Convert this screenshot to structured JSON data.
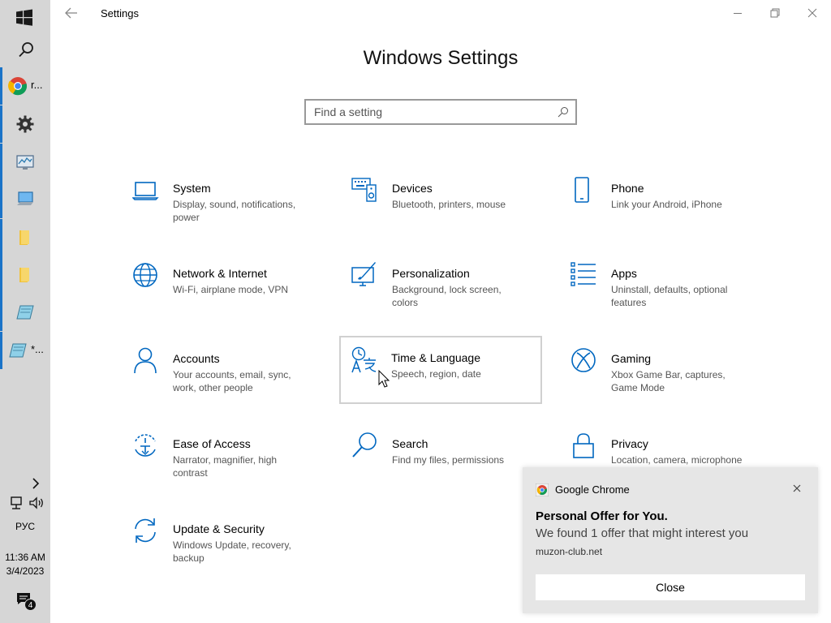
{
  "window": {
    "title": "Settings",
    "back_icon": "back-arrow-icon",
    "controls": [
      "minimize-icon",
      "restore-icon",
      "close-icon"
    ]
  },
  "page": {
    "title": "Windows Settings",
    "search_placeholder": "Find a setting",
    "search_value": ""
  },
  "accent": "#0067c0",
  "categories": [
    {
      "name": "System",
      "desc": "Display, sound, notifications, power",
      "icon": "laptop-icon"
    },
    {
      "name": "Devices",
      "desc": "Bluetooth, printers, mouse",
      "icon": "devices-icon"
    },
    {
      "name": "Phone",
      "desc": "Link your Android, iPhone",
      "icon": "phone-icon"
    },
    {
      "name": "Network & Internet",
      "desc": "Wi-Fi, airplane mode, VPN",
      "icon": "globe-icon"
    },
    {
      "name": "Personalization",
      "desc": "Background, lock screen, colors",
      "icon": "personalization-icon"
    },
    {
      "name": "Apps",
      "desc": "Uninstall, defaults, optional features",
      "icon": "apps-list-icon"
    },
    {
      "name": "Accounts",
      "desc": "Your accounts, email, sync, work, other people",
      "icon": "person-icon"
    },
    {
      "name": "Time & Language",
      "desc": "Speech, region, date",
      "icon": "time-language-icon"
    },
    {
      "name": "Gaming",
      "desc": "Xbox Game Bar, captures, Game Mode",
      "icon": "xbox-icon"
    },
    {
      "name": "Ease of Access",
      "desc": "Narrator, magnifier, high contrast",
      "icon": "ease-of-access-icon"
    },
    {
      "name": "Search",
      "desc": "Find my files, permissions",
      "icon": "search-icon"
    },
    {
      "name": "Privacy",
      "desc": "Location, camera, microphone",
      "icon": "lock-icon"
    },
    {
      "name": "Update & Security",
      "desc": "Windows Update, recovery, backup",
      "icon": "refresh-icon"
    }
  ],
  "taskbar": {
    "chrome_label": "r...",
    "notepad_label": "*...",
    "language": "РУС",
    "time": "11:36 AM",
    "date": "3/4/2023",
    "notification_count": "4"
  },
  "notification": {
    "app": "Google Chrome",
    "title": "Personal Offer for You.",
    "body": "We found 1 offer that might interest you",
    "source": "muzon-club.net",
    "button": "Close"
  }
}
